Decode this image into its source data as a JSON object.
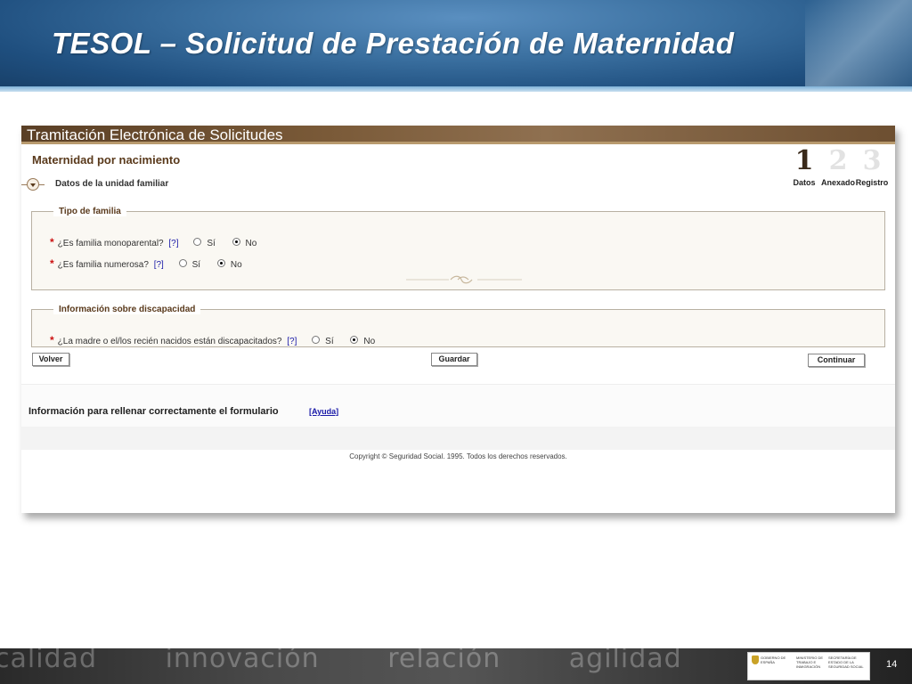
{
  "slide": {
    "title": "TESOL – Solicitud de Prestación de Maternidad",
    "page_number": "14"
  },
  "app": {
    "banner_title": "Tramitación Electrónica de Solicitudes",
    "form_title": "Maternidad por nacimiento",
    "steps": [
      {
        "number": "1",
        "label": "Datos",
        "active": true
      },
      {
        "number": "2",
        "label": "Anexado",
        "active": false
      },
      {
        "number": "3",
        "label": "Registro",
        "active": false
      }
    ],
    "section_title": "Datos de la unidad familiar",
    "groups": {
      "tipo_familia": {
        "legend": "Tipo de familia",
        "questions": [
          {
            "required_mark": "*",
            "text": "¿Es familia monoparental?",
            "help": "[?]",
            "option_yes": "Sí",
            "option_no": "No",
            "selected": "No"
          },
          {
            "required_mark": "*",
            "text": "¿Es familia numerosa?",
            "help": "[?]",
            "option_yes": "Sí",
            "option_no": "No",
            "selected": "No"
          }
        ]
      },
      "discapacidad": {
        "legend": "Información sobre discapacidad",
        "questions": [
          {
            "required_mark": "*",
            "text": "¿La madre o el/los recién nacidos están discapacitados?",
            "help": "[?]",
            "option_yes": "Sí",
            "option_no": "No",
            "selected": "No"
          }
        ]
      }
    },
    "buttons": {
      "volver": "Volver",
      "guardar": "Guardar",
      "continuar": "Continuar"
    },
    "help_text": "Información para rellenar correctamente el formulario",
    "help_link": "[Ayuda]",
    "copyright": "Copyright © Seguridad Social. 1995. Todos los derechos reservados."
  },
  "footer": {
    "words": [
      "calidad",
      "innovación",
      "relación",
      "agilidad"
    ],
    "logo_texts": {
      "gobierno": "GOBIERNO DE ESPAÑA",
      "ministerio": "MINISTERIO DE TRABAJO E INMIGRACIÓN",
      "secretaria": "SECRETARÍA DE ESTADO DE LA SEGURIDAD SOCIAL"
    }
  }
}
